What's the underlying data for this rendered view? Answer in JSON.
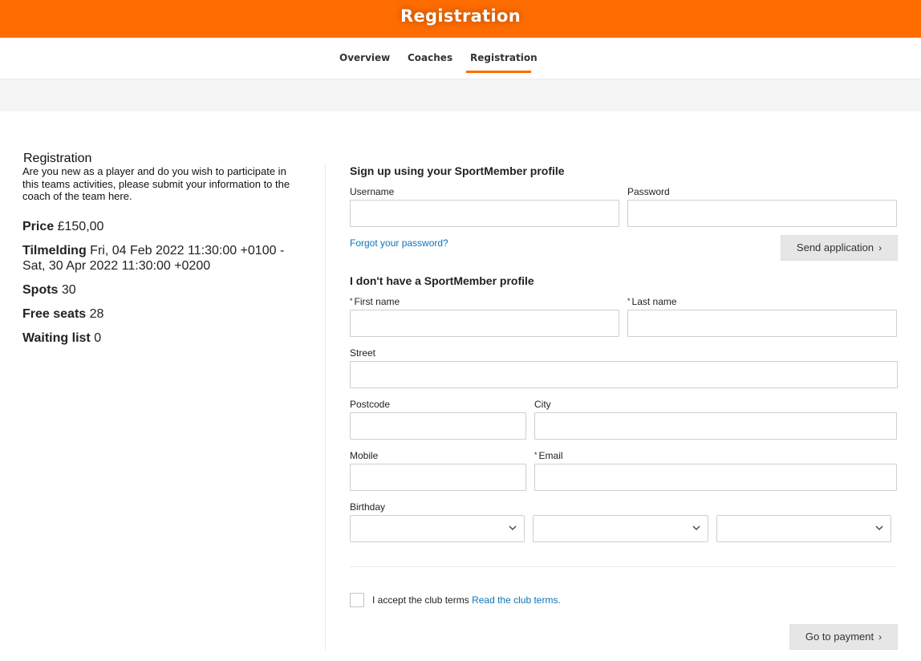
{
  "header": {
    "title": "Registration",
    "accent_color": "#ff6d00"
  },
  "nav": {
    "tabs": [
      {
        "label": "Overview",
        "active": false
      },
      {
        "label": "Coaches",
        "active": false
      },
      {
        "label": "Registration",
        "active": true
      }
    ]
  },
  "info": {
    "title": "Registration",
    "description": "Are you new as a player and do you wish to participate in this teams activities, please submit your information to the coach of the team here.",
    "price_label": "Price",
    "price_value": "£150,00",
    "period_label": "Tilmelding",
    "period_value": "Fri, 04 Feb 2022 11:30:00 +0100 - Sat, 30 Apr 2022 11:30:00 +0200",
    "spots_label": "Spots",
    "spots_value": "30",
    "free_label": "Free seats",
    "free_value": "28",
    "waiting_label": "Waiting list",
    "waiting_value": "0"
  },
  "signin": {
    "heading": "Sign up using your SportMember profile",
    "username_label": "Username",
    "password_label": "Password",
    "forgot_link": "Forgot your password?",
    "send_button": "Send application",
    "arrow": "›"
  },
  "register": {
    "heading": "I don't have a SportMember profile",
    "required_mark": "*",
    "first_name_label": "First name",
    "last_name_label": "Last name",
    "street_label": "Street",
    "postcode_label": "Postcode",
    "city_label": "City",
    "mobile_label": "Mobile",
    "email_label": "Email",
    "birthday_label": "Birthday",
    "birthday_day": "",
    "birthday_month": "",
    "birthday_year": ""
  },
  "terms": {
    "text": "I accept the club terms",
    "link": "Read the club terms."
  },
  "payment": {
    "button": "Go to payment",
    "arrow": "›"
  }
}
